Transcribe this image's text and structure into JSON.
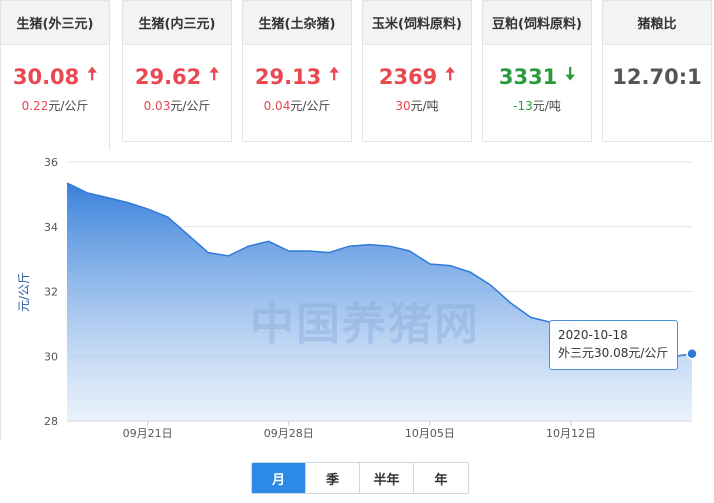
{
  "cards": [
    {
      "title": "生猪(外三元)",
      "price": "30.08",
      "direction": "up",
      "change": "0.22",
      "unit": "元/公斤"
    },
    {
      "title": "生猪(内三元)",
      "price": "29.62",
      "direction": "up",
      "change": "0.03",
      "unit": "元/公斤"
    },
    {
      "title": "生猪(土杂猪)",
      "price": "29.13",
      "direction": "up",
      "change": "0.04",
      "unit": "元/公斤"
    },
    {
      "title": "玉米(饲料原料)",
      "price": "2369",
      "direction": "up",
      "change": "30",
      "unit": "元/吨"
    },
    {
      "title": "豆粕(饲料原料)",
      "price": "3331",
      "direction": "down",
      "change": "-13",
      "unit": "元/吨"
    },
    {
      "title": "猪粮比",
      "price": "12.70:1",
      "direction": "none",
      "change": "",
      "unit": ""
    }
  ],
  "colors": {
    "up": "#e8484f",
    "down": "#2a9a3c",
    "accent": "#2a8ae6"
  },
  "watermark": "中国养猪网",
  "tooltip": {
    "date": "2020-10-18",
    "text": "外三元30.08元/公斤"
  },
  "ranges": [
    {
      "label": "月",
      "active": true
    },
    {
      "label": "季",
      "active": false
    },
    {
      "label": "半年",
      "active": false
    },
    {
      "label": "年",
      "active": false
    }
  ],
  "chart_data": {
    "type": "area",
    "ylabel": "元/公斤",
    "ylim": [
      28,
      36
    ],
    "yticks": [
      28,
      30,
      32,
      34,
      36
    ],
    "xlim": [
      "2020-09-17",
      "2020-10-18"
    ],
    "xticks": [
      {
        "date": "2020-09-21",
        "label": "09月21日"
      },
      {
        "date": "2020-09-28",
        "label": "09月28日"
      },
      {
        "date": "2020-10-05",
        "label": "10月05日"
      },
      {
        "date": "2020-10-12",
        "label": "10月12日"
      }
    ],
    "grid": true,
    "series": [
      {
        "values": [
          {
            "x": "2020-09-17",
            "y": 35.35
          },
          {
            "x": "2020-09-18",
            "y": 35.05
          },
          {
            "x": "2020-09-19",
            "y": 34.9
          },
          {
            "x": "2020-09-20",
            "y": 34.75
          },
          {
            "x": "2020-09-21",
            "y": 34.55
          },
          {
            "x": "2020-09-22",
            "y": 34.3
          },
          {
            "x": "2020-09-23",
            "y": 33.75
          },
          {
            "x": "2020-09-24",
            "y": 33.2
          },
          {
            "x": "2020-09-25",
            "y": 33.1
          },
          {
            "x": "2020-09-26",
            "y": 33.4
          },
          {
            "x": "2020-09-27",
            "y": 33.55
          },
          {
            "x": "2020-09-28",
            "y": 33.25
          },
          {
            "x": "2020-09-29",
            "y": 33.25
          },
          {
            "x": "2020-09-30",
            "y": 33.2
          },
          {
            "x": "2020-10-01",
            "y": 33.4
          },
          {
            "x": "2020-10-02",
            "y": 33.45
          },
          {
            "x": "2020-10-03",
            "y": 33.4
          },
          {
            "x": "2020-10-04",
            "y": 33.25
          },
          {
            "x": "2020-10-05",
            "y": 32.85
          },
          {
            "x": "2020-10-06",
            "y": 32.8
          },
          {
            "x": "2020-10-07",
            "y": 32.6
          },
          {
            "x": "2020-10-08",
            "y": 32.2
          },
          {
            "x": "2020-10-09",
            "y": 31.65
          },
          {
            "x": "2020-10-10",
            "y": 31.2
          },
          {
            "x": "2020-10-11",
            "y": 31.05
          },
          {
            "x": "2020-10-12",
            "y": 31.0
          },
          {
            "x": "2020-10-13",
            "y": 30.75
          },
          {
            "x": "2020-10-14",
            "y": 30.5
          },
          {
            "x": "2020-10-15",
            "y": 30.3
          },
          {
            "x": "2020-10-16",
            "y": 30.15
          },
          {
            "x": "2020-10-17",
            "y": 29.98
          },
          {
            "x": "2020-10-18",
            "y": 30.08
          }
        ]
      }
    ]
  }
}
